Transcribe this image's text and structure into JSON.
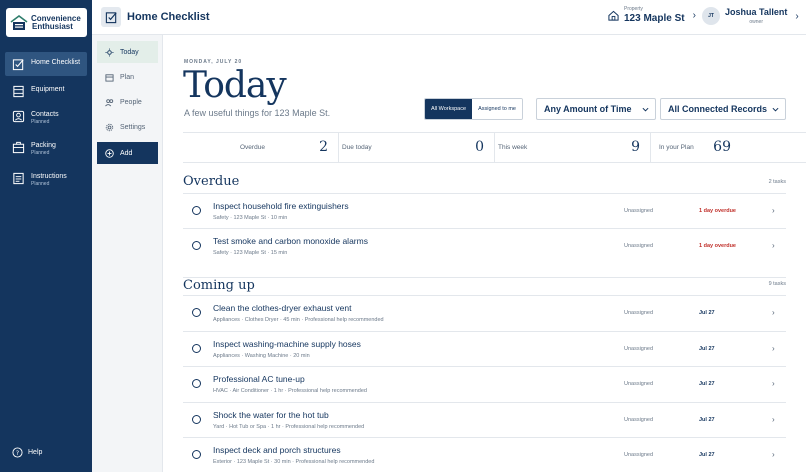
{
  "brand": {
    "name_line1": "Convenience",
    "name_line2": "Enthusiast"
  },
  "nav": {
    "items": [
      {
        "label": "Home Checklist",
        "sub": "",
        "icon": "checklist-icon"
      },
      {
        "label": "Equipment",
        "sub": "",
        "icon": "equipment-icon"
      },
      {
        "label": "Contacts",
        "sub": "Planned",
        "icon": "contacts-icon"
      },
      {
        "label": "Packing",
        "sub": "Planned",
        "icon": "packing-icon"
      },
      {
        "label": "Instructions",
        "sub": "Planned",
        "icon": "instructions-icon"
      }
    ],
    "help": "Help"
  },
  "header": {
    "title": "Home Checklist",
    "property_label": "Property",
    "property_name": "123 Maple St",
    "user_initials": "JT",
    "user_name": "Joshua Tallent",
    "user_role": "owner"
  },
  "subnav": {
    "items": [
      {
        "label": "Today"
      },
      {
        "label": "Plan"
      },
      {
        "label": "People"
      },
      {
        "label": "Settings"
      }
    ],
    "add": "Add"
  },
  "main": {
    "date": "MONDAY, JULY 20",
    "title": "Today",
    "subtitle": "A few useful things for 123 Maple St.",
    "filters": {
      "all_workspace": "All Workspace",
      "assigned_to_me": "Assigned to me",
      "time": "Any Amount of Time",
      "records": "All Connected Records"
    },
    "stats": [
      {
        "label": "Overdue",
        "value": "2"
      },
      {
        "label": "Due today",
        "value": "0"
      },
      {
        "label": "This week",
        "value": "9"
      },
      {
        "label": "In your Plan",
        "value": "69"
      }
    ],
    "overdue": {
      "title": "Overdue",
      "count": "2 tasks",
      "tasks": [
        {
          "title": "Inspect household fire extinguishers",
          "meta": "Safety · 123 Maple St · 10 min",
          "assignee": "Unassigned",
          "due": "1 day overdue"
        },
        {
          "title": "Test smoke and carbon monoxide alarms",
          "meta": "Safety · 123 Maple St · 15 min",
          "assignee": "Unassigned",
          "due": "1 day overdue"
        }
      ]
    },
    "coming_up": {
      "title": "Coming up",
      "count": "9 tasks",
      "tasks": [
        {
          "title": "Clean the clothes-dryer exhaust vent",
          "meta": "Appliances · Clothes Dryer · 45 min · Professional help recommended",
          "assignee": "Unassigned",
          "due": "Jul 27"
        },
        {
          "title": "Inspect washing-machine supply hoses",
          "meta": "Appliances · Washing Machine · 20 min",
          "assignee": "Unassigned",
          "due": "Jul 27"
        },
        {
          "title": "Professional AC tune-up",
          "meta": "HVAC · Air Conditioner · 1 hr · Professional help recommended",
          "assignee": "Unassigned",
          "due": "Jul 27"
        },
        {
          "title": "Shock the water for the hot tub",
          "meta": "Yard · Hot Tub or Spa · 1 hr · Professional help recommended",
          "assignee": "Unassigned",
          "due": "Jul 27"
        },
        {
          "title": "Inspect deck and porch structures",
          "meta": "Exterior · 123 Maple St · 30 min · Professional help recommended",
          "assignee": "Unassigned",
          "due": "Jul 27"
        }
      ]
    }
  },
  "colors": {
    "nav_bg": "#14355e",
    "accent": "#14355e",
    "overdue": "#c0302b",
    "active_sub": "#e3eee9"
  }
}
